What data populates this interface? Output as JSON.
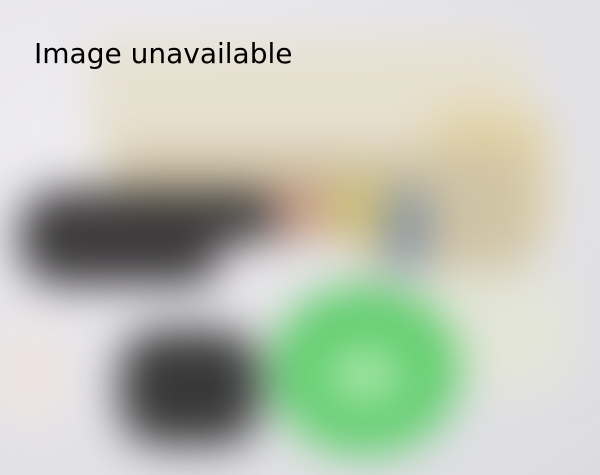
{
  "message": {
    "text": "Image unavailable"
  }
}
